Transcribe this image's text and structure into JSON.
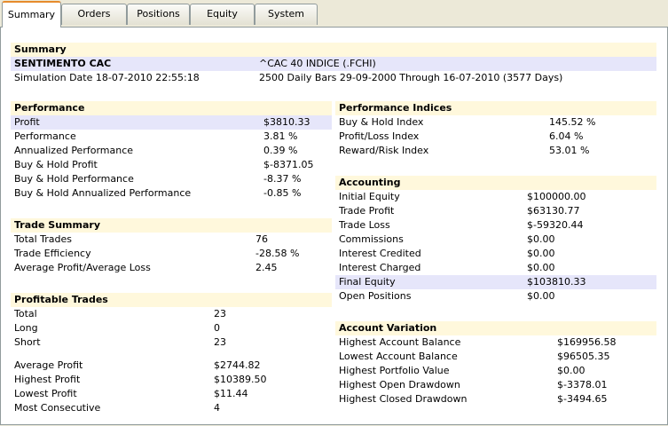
{
  "tabs": [
    {
      "label": "Summary",
      "active": true
    },
    {
      "label": "Orders"
    },
    {
      "label": "Positions"
    },
    {
      "label": "Equity"
    },
    {
      "label": "System"
    }
  ],
  "summary": {
    "header": "Summary",
    "system_name": "SENTIMENTO CAC",
    "instrument": "^CAC 40 INDICE (.FCHI)",
    "sim_date": "Simulation Date 18-07-2010 22:55:18",
    "bars": "2500 Daily Bars 29-09-2000 Through 16-07-2010 (3577 Days)"
  },
  "performance": {
    "header": "Performance",
    "rows": [
      {
        "label": "Profit",
        "value": "$3810.33"
      },
      {
        "label": "Performance",
        "value": "3.81 %"
      },
      {
        "label": "Annualized Performance",
        "value": "0.39 %"
      },
      {
        "label": "Buy & Hold Profit",
        "value": "$-8371.05"
      },
      {
        "label": "Buy & Hold Performance",
        "value": "-8.37 %"
      },
      {
        "label": "Buy & Hold Annualized Performance",
        "value": "-0.85 %"
      }
    ]
  },
  "trade_summary": {
    "header": "Trade Summary",
    "rows": [
      {
        "label": "Total Trades",
        "value": "76"
      },
      {
        "label": "Trade Efficiency",
        "value": "-28.58 %"
      },
      {
        "label": "Average Profit/Average Loss",
        "value": "2.45"
      }
    ]
  },
  "profitable_trades": {
    "header": "Profitable Trades",
    "rows": [
      {
        "label": "Total",
        "value": "23"
      },
      {
        "label": "Long",
        "value": "0"
      },
      {
        "label": "Short",
        "value": "23"
      },
      {
        "label": "Average Profit",
        "value": "$2744.82"
      },
      {
        "label": "Highest Profit",
        "value": "$10389.50"
      },
      {
        "label": "Lowest Profit",
        "value": "$11.44"
      },
      {
        "label": "Most Consecutive",
        "value": "4"
      }
    ]
  },
  "performance_indices": {
    "header": "Performance Indices",
    "rows": [
      {
        "label": "Buy & Hold Index",
        "value": "145.52 %"
      },
      {
        "label": "Profit/Loss Index",
        "value": "6.04 %"
      },
      {
        "label": "Reward/Risk Index",
        "value": "53.01 %"
      }
    ]
  },
  "accounting": {
    "header": "Accounting",
    "rows": [
      {
        "label": "Initial Equity",
        "value": "$100000.00"
      },
      {
        "label": "Trade Profit",
        "value": "$63130.77"
      },
      {
        "label": "Trade Loss",
        "value": "$-59320.44"
      },
      {
        "label": "Commissions",
        "value": "$0.00"
      },
      {
        "label": "Interest Credited",
        "value": "$0.00"
      },
      {
        "label": "Interest Charged",
        "value": "$0.00"
      },
      {
        "label": "Final Equity",
        "value": "$103810.33"
      },
      {
        "label": "Open Positions",
        "value": "$0.00"
      }
    ]
  },
  "account_variation": {
    "header": "Account Variation",
    "rows": [
      {
        "label": "Highest Account Balance",
        "value": "$169956.58"
      },
      {
        "label": "Lowest Account Balance",
        "value": "$96505.35"
      },
      {
        "label": "Highest Portfolio Value",
        "value": "$0.00"
      },
      {
        "label": "Highest Open Drawdown",
        "value": "$-3378.01"
      },
      {
        "label": "Highest Closed Drawdown",
        "value": "$-3494.65"
      }
    ]
  },
  "colors": {
    "section_header_bg": "#fff8dc",
    "highlight_row_bg": "#e6e6fa",
    "active_tab_accent": "#e68b2c"
  }
}
